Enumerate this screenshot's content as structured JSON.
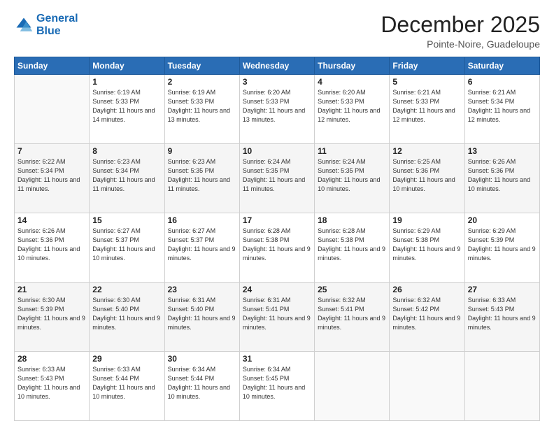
{
  "header": {
    "logo_line1": "General",
    "logo_line2": "Blue",
    "title": "December 2025",
    "subtitle": "Pointe-Noire, Guadeloupe"
  },
  "days_of_week": [
    "Sunday",
    "Monday",
    "Tuesday",
    "Wednesday",
    "Thursday",
    "Friday",
    "Saturday"
  ],
  "weeks": [
    [
      {
        "day": "",
        "sunrise": "",
        "sunset": "",
        "daylight": ""
      },
      {
        "day": "1",
        "sunrise": "6:19 AM",
        "sunset": "5:33 PM",
        "daylight": "11 hours and 14 minutes."
      },
      {
        "day": "2",
        "sunrise": "6:19 AM",
        "sunset": "5:33 PM",
        "daylight": "11 hours and 13 minutes."
      },
      {
        "day": "3",
        "sunrise": "6:20 AM",
        "sunset": "5:33 PM",
        "daylight": "11 hours and 13 minutes."
      },
      {
        "day": "4",
        "sunrise": "6:20 AM",
        "sunset": "5:33 PM",
        "daylight": "11 hours and 12 minutes."
      },
      {
        "day": "5",
        "sunrise": "6:21 AM",
        "sunset": "5:33 PM",
        "daylight": "11 hours and 12 minutes."
      },
      {
        "day": "6",
        "sunrise": "6:21 AM",
        "sunset": "5:34 PM",
        "daylight": "11 hours and 12 minutes."
      }
    ],
    [
      {
        "day": "7",
        "sunrise": "6:22 AM",
        "sunset": "5:34 PM",
        "daylight": "11 hours and 11 minutes."
      },
      {
        "day": "8",
        "sunrise": "6:23 AM",
        "sunset": "5:34 PM",
        "daylight": "11 hours and 11 minutes."
      },
      {
        "day": "9",
        "sunrise": "6:23 AM",
        "sunset": "5:35 PM",
        "daylight": "11 hours and 11 minutes."
      },
      {
        "day": "10",
        "sunrise": "6:24 AM",
        "sunset": "5:35 PM",
        "daylight": "11 hours and 11 minutes."
      },
      {
        "day": "11",
        "sunrise": "6:24 AM",
        "sunset": "5:35 PM",
        "daylight": "11 hours and 10 minutes."
      },
      {
        "day": "12",
        "sunrise": "6:25 AM",
        "sunset": "5:36 PM",
        "daylight": "11 hours and 10 minutes."
      },
      {
        "day": "13",
        "sunrise": "6:26 AM",
        "sunset": "5:36 PM",
        "daylight": "11 hours and 10 minutes."
      }
    ],
    [
      {
        "day": "14",
        "sunrise": "6:26 AM",
        "sunset": "5:36 PM",
        "daylight": "11 hours and 10 minutes."
      },
      {
        "day": "15",
        "sunrise": "6:27 AM",
        "sunset": "5:37 PM",
        "daylight": "11 hours and 10 minutes."
      },
      {
        "day": "16",
        "sunrise": "6:27 AM",
        "sunset": "5:37 PM",
        "daylight": "11 hours and 9 minutes."
      },
      {
        "day": "17",
        "sunrise": "6:28 AM",
        "sunset": "5:38 PM",
        "daylight": "11 hours and 9 minutes."
      },
      {
        "day": "18",
        "sunrise": "6:28 AM",
        "sunset": "5:38 PM",
        "daylight": "11 hours and 9 minutes."
      },
      {
        "day": "19",
        "sunrise": "6:29 AM",
        "sunset": "5:38 PM",
        "daylight": "11 hours and 9 minutes."
      },
      {
        "day": "20",
        "sunrise": "6:29 AM",
        "sunset": "5:39 PM",
        "daylight": "11 hours and 9 minutes."
      }
    ],
    [
      {
        "day": "21",
        "sunrise": "6:30 AM",
        "sunset": "5:39 PM",
        "daylight": "11 hours and 9 minutes."
      },
      {
        "day": "22",
        "sunrise": "6:30 AM",
        "sunset": "5:40 PM",
        "daylight": "11 hours and 9 minutes."
      },
      {
        "day": "23",
        "sunrise": "6:31 AM",
        "sunset": "5:40 PM",
        "daylight": "11 hours and 9 minutes."
      },
      {
        "day": "24",
        "sunrise": "6:31 AM",
        "sunset": "5:41 PM",
        "daylight": "11 hours and 9 minutes."
      },
      {
        "day": "25",
        "sunrise": "6:32 AM",
        "sunset": "5:41 PM",
        "daylight": "11 hours and 9 minutes."
      },
      {
        "day": "26",
        "sunrise": "6:32 AM",
        "sunset": "5:42 PM",
        "daylight": "11 hours and 9 minutes."
      },
      {
        "day": "27",
        "sunrise": "6:33 AM",
        "sunset": "5:43 PM",
        "daylight": "11 hours and 9 minutes."
      }
    ],
    [
      {
        "day": "28",
        "sunrise": "6:33 AM",
        "sunset": "5:43 PM",
        "daylight": "11 hours and 10 minutes."
      },
      {
        "day": "29",
        "sunrise": "6:33 AM",
        "sunset": "5:44 PM",
        "daylight": "11 hours and 10 minutes."
      },
      {
        "day": "30",
        "sunrise": "6:34 AM",
        "sunset": "5:44 PM",
        "daylight": "11 hours and 10 minutes."
      },
      {
        "day": "31",
        "sunrise": "6:34 AM",
        "sunset": "5:45 PM",
        "daylight": "11 hours and 10 minutes."
      },
      {
        "day": "",
        "sunrise": "",
        "sunset": "",
        "daylight": ""
      },
      {
        "day": "",
        "sunrise": "",
        "sunset": "",
        "daylight": ""
      },
      {
        "day": "",
        "sunrise": "",
        "sunset": "",
        "daylight": ""
      }
    ]
  ]
}
